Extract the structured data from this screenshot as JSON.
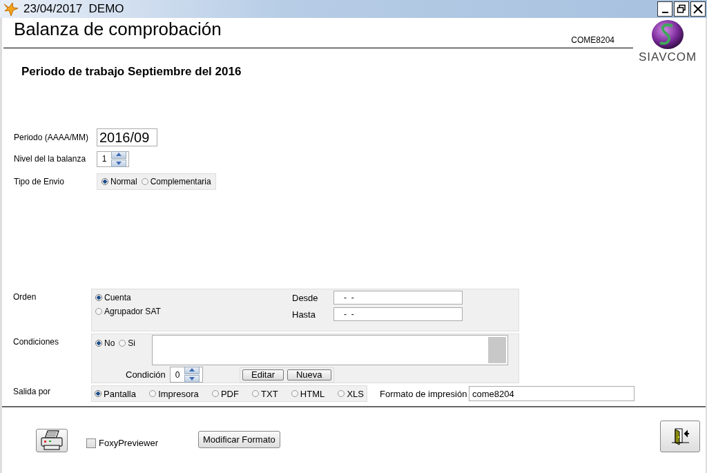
{
  "window": {
    "title": "23/04/2017  DEMO"
  },
  "header": {
    "title": "Balanza de comprobación",
    "code": "COME8204",
    "logo_text": "SIAVCOM"
  },
  "subtitle": "Periodo de trabajo Septiembre del 2016",
  "periodo": {
    "label": "Periodo (AAAA/MM)",
    "value": "2016/09"
  },
  "nivel": {
    "label": "Nivel del la balanza",
    "value": "1"
  },
  "tipo_envio": {
    "label": "Tipo de Envio",
    "options": [
      {
        "label": "Normal",
        "selected": true
      },
      {
        "label": "Complementaria",
        "selected": false
      }
    ]
  },
  "orden": {
    "label": "Orden",
    "options": [
      {
        "label": "Cuenta",
        "selected": true
      },
      {
        "label": "Agrupador SAT",
        "selected": false
      }
    ],
    "desde": {
      "label": "Desde",
      "value": "-  -"
    },
    "hasta": {
      "label": "Hasta",
      "value": "-  -"
    }
  },
  "condiciones": {
    "label": "Condiciones",
    "options": [
      {
        "label": "No",
        "selected": true
      },
      {
        "label": "Si",
        "selected": false
      }
    ],
    "condicion": {
      "label": "Condición",
      "value": "0"
    },
    "buttons": [
      "Editar",
      "Nueva"
    ]
  },
  "salida": {
    "label": "Salida por",
    "options": [
      {
        "label": "Pantalla",
        "selected": true
      },
      {
        "label": "Impresora",
        "selected": false
      },
      {
        "label": "PDF",
        "selected": false
      },
      {
        "label": "TXT",
        "selected": false
      },
      {
        "label": "HTML",
        "selected": false
      },
      {
        "label": "XLS",
        "selected": false
      }
    ],
    "formato": {
      "label": "Formato de impresión",
      "value": "come8204"
    }
  },
  "footer": {
    "foxy": {
      "label": "FoxyPreviewer",
      "checked": false
    },
    "modificar": "Modificar Formato"
  }
}
